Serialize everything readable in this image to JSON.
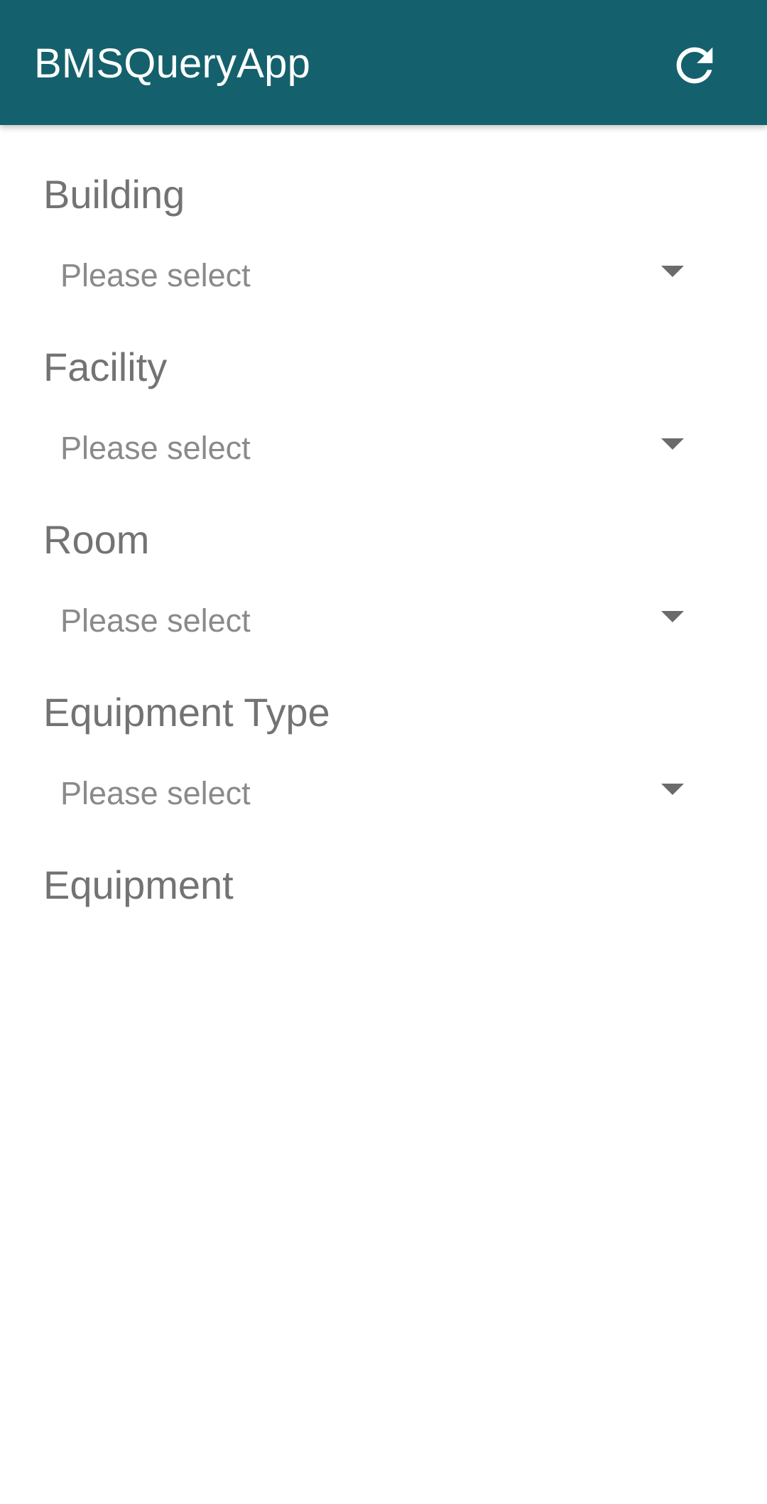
{
  "app_bar": {
    "title": "BMSQueryApp",
    "refresh_icon": "refresh-icon",
    "background_color": "#14616d"
  },
  "form": {
    "building": {
      "label": "Building",
      "selected": "Please select"
    },
    "facility": {
      "label": "Facility",
      "selected": "Please select"
    },
    "room": {
      "label": "Room",
      "selected": "Please select"
    },
    "equipment_type": {
      "label": "Equipment Type",
      "selected": "Please select"
    },
    "equipment": {
      "label": "Equipment"
    }
  },
  "icons": {
    "dropdown": "caret-down-icon"
  }
}
